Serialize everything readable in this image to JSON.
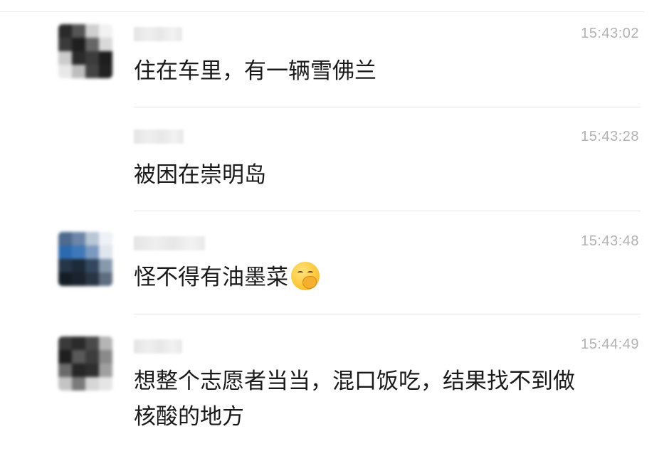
{
  "messages": [
    {
      "time": "15:43:02",
      "text": "住在车里，有一辆雪佛兰"
    },
    {
      "time": "15:43:28",
      "text": "被困在崇明岛"
    },
    {
      "time": "15:43:48",
      "text": "怪不得有油墨菜",
      "emoji": "thinking-face-emoji"
    },
    {
      "time": "15:44:49",
      "text_line1": "想整个志愿者当当，混口饭吃，结果找不到做",
      "text_line2": "核酸的地方"
    }
  ],
  "colors": {
    "timestamp": "#b2b2b2",
    "message_text": "#1a1a1a",
    "divider": "#e5e5e5",
    "background": "#ffffff"
  }
}
